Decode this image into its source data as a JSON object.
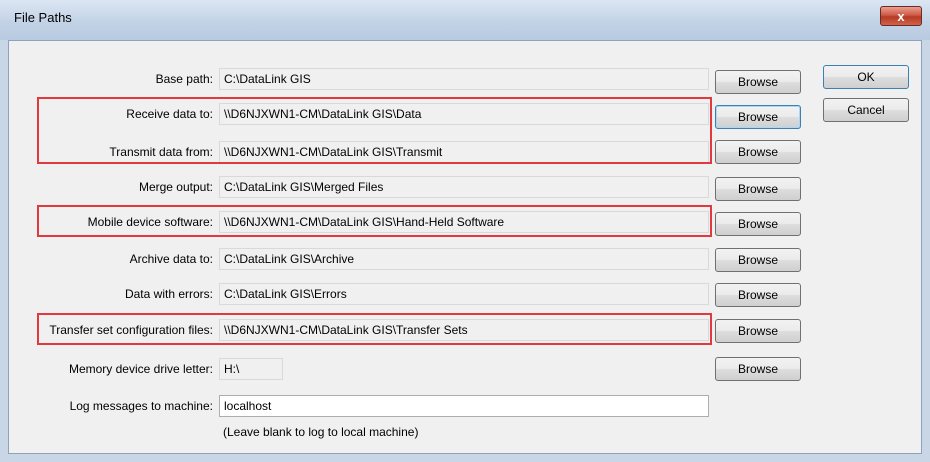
{
  "window": {
    "title": "File Paths",
    "close_label": "x"
  },
  "buttons": {
    "ok": "OK",
    "cancel": "Cancel",
    "browse": "Browse"
  },
  "rows": [
    {
      "label": "Base path:",
      "value": "C:\\DataLink GIS"
    },
    {
      "label": "Receive data to:",
      "value": "\\\\D6NJXWN1-CM\\DataLink GIS\\Data"
    },
    {
      "label": "Transmit data from:",
      "value": "\\\\D6NJXWN1-CM\\DataLink GIS\\Transmit"
    },
    {
      "label": "Merge output:",
      "value": "C:\\DataLink GIS\\Merged Files"
    },
    {
      "label": "Mobile device software:",
      "value": "\\\\D6NJXWN1-CM\\DataLink GIS\\Hand-Held Software"
    },
    {
      "label": "Archive data to:",
      "value": "C:\\DataLink GIS\\Archive"
    },
    {
      "label": "Data with errors:",
      "value": "C:\\DataLink GIS\\Errors"
    },
    {
      "label": "Transfer set configuration files:",
      "value": "\\\\D6NJXWN1-CM\\DataLink GIS\\Transfer Sets"
    },
    {
      "label": "Memory device drive letter:",
      "value": "H:\\"
    },
    {
      "label": "Log messages to machine:",
      "value": "localhost"
    }
  ],
  "log_note": "(Leave blank to log to local machine)",
  "highlight_color": "#e0393e"
}
